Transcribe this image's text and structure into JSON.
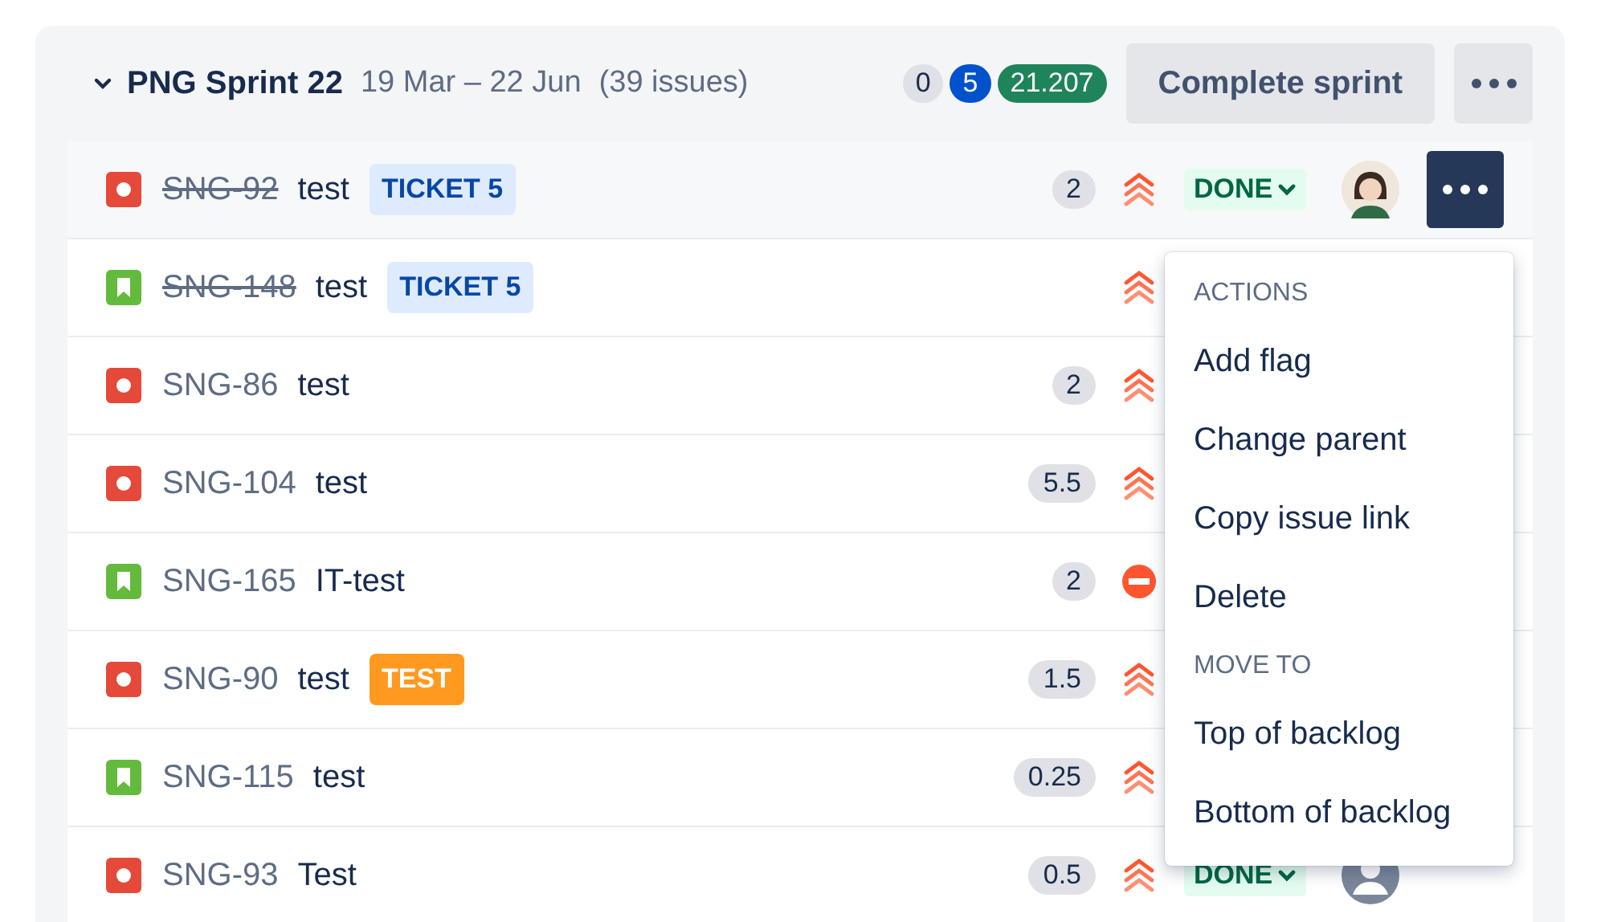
{
  "sprint": {
    "expanded": true,
    "title": "PNG Sprint 22",
    "dates": "19 Mar – 22 Jun",
    "issue_count": "(39 issues)",
    "counts": [
      {
        "text": "0",
        "color": "#dfe1e6"
      },
      {
        "text": "5",
        "color": "#0052cc"
      },
      {
        "text": "21.207",
        "color": "#1f845a"
      }
    ],
    "complete_button": "Complete sprint"
  },
  "issues": [
    {
      "kind": "bug",
      "key": "SNG-92",
      "resolved": true,
      "summary": "test",
      "label": {
        "text": "TICKET 5",
        "kind": "ticket"
      },
      "estimate": "2",
      "priority": {
        "kind": "highest"
      },
      "status": "DONE",
      "avatar": {
        "kind": "photo"
      },
      "open_menu": {
        "sections": [
          {
            "heading": "ACTIONS",
            "items": [
              "Add flag",
              "Change parent",
              "Copy issue link",
              "Delete"
            ]
          },
          {
            "heading": "MOVE TO",
            "items": [
              "Top of backlog",
              "Bottom of backlog"
            ]
          }
        ]
      }
    },
    {
      "kind": "story",
      "key": "SNG-148",
      "resolved": true,
      "summary": "test",
      "label": {
        "text": "TICKET 5",
        "kind": "ticket"
      },
      "priority": {
        "kind": "highest"
      }
    },
    {
      "kind": "bug",
      "key": "SNG-86",
      "resolved": false,
      "summary": "test",
      "estimate": "2",
      "priority": {
        "kind": "highest"
      }
    },
    {
      "kind": "bug",
      "key": "SNG-104",
      "resolved": false,
      "summary": "test",
      "estimate": "5.5",
      "priority": {
        "kind": "highest"
      }
    },
    {
      "kind": "story",
      "key": "SNG-165",
      "resolved": false,
      "summary": "IT-test",
      "estimate": "2",
      "priority": {
        "kind": "blocker"
      }
    },
    {
      "kind": "bug",
      "key": "SNG-90",
      "resolved": false,
      "summary": "test",
      "label": {
        "text": "TEST",
        "kind": "test"
      },
      "estimate": "1.5",
      "priority": {
        "kind": "highest"
      }
    },
    {
      "kind": "story",
      "key": "SNG-115",
      "resolved": false,
      "summary": "test",
      "estimate": "0.25",
      "priority": {
        "kind": "highest"
      }
    },
    {
      "kind": "bug",
      "key": "SNG-93",
      "resolved": false,
      "summary": "Test",
      "estimate": "0.5",
      "priority": {
        "kind": "highest"
      },
      "status": "DONE",
      "avatar": {
        "kind": "default"
      }
    }
  ]
}
